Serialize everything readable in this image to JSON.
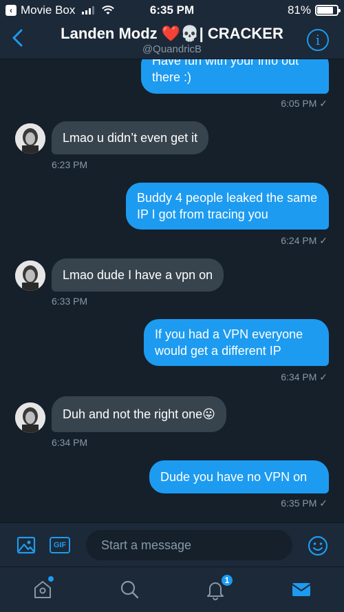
{
  "status_bar": {
    "back_app": "Movie Box",
    "time": "6:35 PM",
    "battery": "81%",
    "battery_level": 0.81
  },
  "header": {
    "title": "Landen Modz ❤️💀| CRACKER",
    "handle": "@QuandricB",
    "info_icon": "info-icon"
  },
  "messages": [
    {
      "direction": "out",
      "text": "Have fun with your info out there :)",
      "time": "6:05 PM ✓"
    },
    {
      "direction": "in",
      "text": "Lmao u didn’t even get it",
      "time": "6:23 PM"
    },
    {
      "direction": "out",
      "text": "Buddy 4 people leaked the same IP I got from tracing you",
      "time": "6:24 PM ✓"
    },
    {
      "direction": "in",
      "text": "Lmao dude I have a vpn on",
      "time": "6:33 PM"
    },
    {
      "direction": "out",
      "text": "If you had a VPN everyone would get a different IP",
      "time": "6:34 PM ✓"
    },
    {
      "direction": "in",
      "text": "Duh and not the right one😛",
      "time": "6:34 PM"
    },
    {
      "direction": "out",
      "text": "Dude you have no VPN on",
      "time": "6:35 PM ✓"
    }
  ],
  "composer": {
    "placeholder": "Start a message",
    "gif_label": "GIF"
  },
  "tabbar": {
    "notifications_count": "1"
  },
  "colors": {
    "background": "#15202b",
    "panel": "#1c2938",
    "accent": "#1d9bf0",
    "incoming_bubble": "#38444d",
    "muted_text": "#8899a6"
  }
}
